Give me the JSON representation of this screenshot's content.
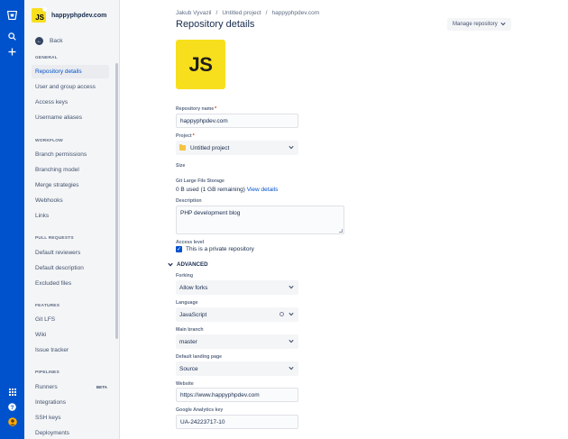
{
  "global_nav": {
    "icons": [
      "bitbucket-logo-icon",
      "search-icon",
      "create-plus-icon",
      "app-switcher-icon",
      "help-icon",
      "user-avatar-icon"
    ]
  },
  "sidebar": {
    "project_name": "happyphpdev.com",
    "project_logo_text": "JS",
    "back_label": "Back",
    "sections": {
      "general": "GENERAL",
      "workflow": "WORKFLOW",
      "pull_requests": "PULL REQUESTS",
      "features": "FEATURES",
      "pipelines": "PIPELINES"
    },
    "items": {
      "repository_details": "Repository details",
      "user_group_access": "User and group access",
      "access_keys": "Access keys",
      "username_aliases": "Username aliases",
      "branch_permissions": "Branch permissions",
      "branching_model": "Branching model",
      "merge_strategies": "Merge strategies",
      "webhooks": "Webhooks",
      "links": "Links",
      "default_reviewers": "Default reviewers",
      "default_description": "Default description",
      "excluded_files": "Excluded files",
      "git_lfs": "Git LFS",
      "wiki": "Wiki",
      "issue_tracker": "Issue tracker",
      "runners": "Runners",
      "runners_badge": "BETA",
      "integrations": "Integrations",
      "ssh_keys": "SSH keys",
      "deployments": "Deployments"
    }
  },
  "breadcrumb": {
    "user": "Jakub Vyvazil",
    "sep": "/",
    "project": "Untitled project",
    "repo": "happyphpdev.com"
  },
  "page": {
    "title": "Repository details",
    "manage_button": "Manage repository",
    "logo_text": "JS"
  },
  "form": {
    "repo_name_label": "Repository name",
    "repo_name_value": "happyphpdev.com",
    "required_mark": "*",
    "project_label": "Project",
    "project_value": "Untitled project",
    "size_label": "Size",
    "lfs_label": "Git Large File Storage",
    "lfs_value": "0 B used (1 GB remaining)",
    "lfs_link": "View details",
    "description_label": "Description",
    "description_value": "PHP development blog",
    "access_label": "Access level",
    "private_label": "This is a private repository",
    "private_checked": true,
    "advanced_label": "ADVANCED",
    "forking_label": "Forking",
    "forking_value": "Allow forks",
    "language_label": "Language",
    "language_value": "JavaScript",
    "main_branch_label": "Main branch",
    "main_branch_value": "master",
    "landing_label": "Default landing page",
    "landing_value": "Source",
    "website_label": "Website",
    "website_value": "https://www.happyphpdev.com",
    "ga_label": "Google Analytics key",
    "ga_value": "UA-24223717-10"
  },
  "colors": {
    "global_nav": "#0052cc",
    "sidebar_bg": "#f4f5f7",
    "js_yellow": "#f7df1e",
    "link": "#0052cc"
  }
}
